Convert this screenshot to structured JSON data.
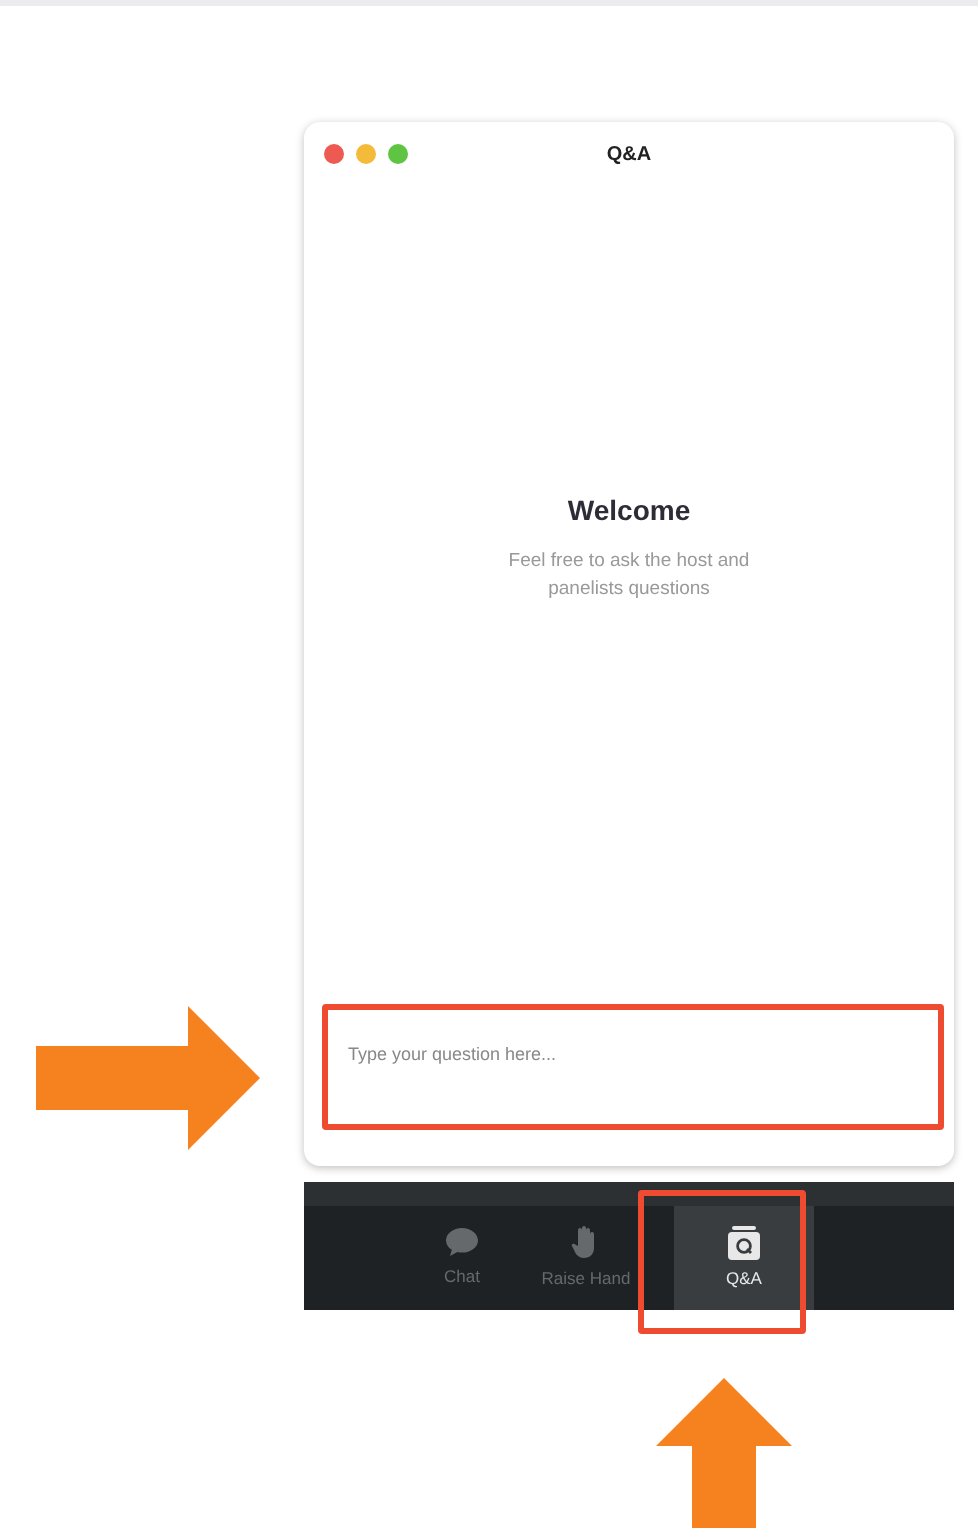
{
  "window": {
    "title": "Q&A"
  },
  "welcome": {
    "heading": "Welcome",
    "text": "Feel free to ask the host and panelists questions"
  },
  "question_field": {
    "placeholder": "Type your question here..."
  },
  "toolbar": [
    {
      "kind": "chat",
      "label": "Chat",
      "selected": false
    },
    {
      "kind": "hand",
      "label": "Raise Hand",
      "selected": false
    },
    {
      "kind": "qa",
      "label": "Q&A",
      "selected": true
    }
  ]
}
